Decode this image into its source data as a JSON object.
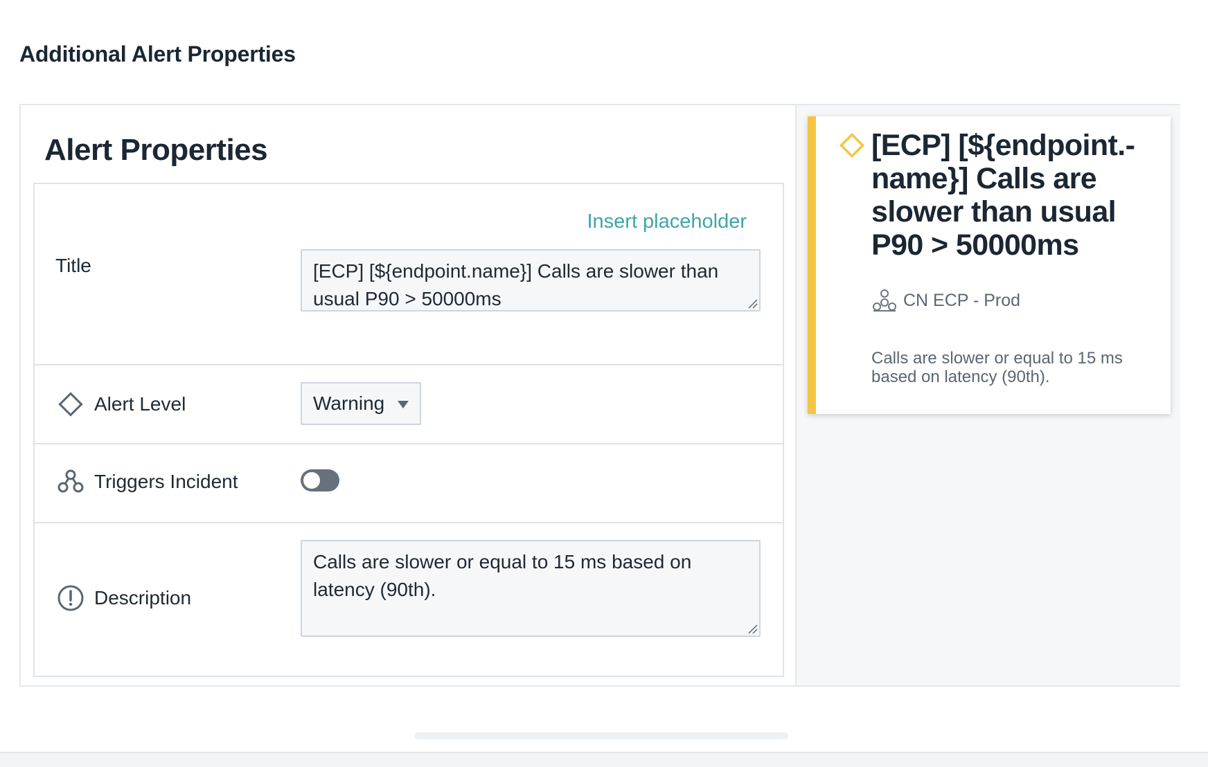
{
  "section": {
    "title": "Additional Alert Properties"
  },
  "panel": {
    "heading": "Alert Properties"
  },
  "form": {
    "insert_placeholder": "Insert placeholder",
    "title_label": "Title",
    "title_value": "[ECP] [${endpoint.name}] Calls are slower than usual P90 > 50000ms",
    "alert_level_label": "Alert Level",
    "alert_level_value": "Warning",
    "triggers_incident_label": "Triggers Incident",
    "triggers_incident_on": false,
    "description_label": "Description",
    "description_value": "Calls are slower or equal to 15 ms based on latency (90th)."
  },
  "preview": {
    "title": "[ECP] [${endpoint.-name}] Calls are slower than usual P90 > 50000ms",
    "entity": "CN ECP - Prod",
    "description": "Calls are slower or equal to 15 ms based on latency (90th).",
    "accent_color": "#f5c542",
    "level_icon": "diamond-icon",
    "entity_icon": "entity-cluster-icon"
  },
  "colors": {
    "link": "#3fa5a8",
    "warning": "#f5c542",
    "toggle_off": "#66717c"
  }
}
